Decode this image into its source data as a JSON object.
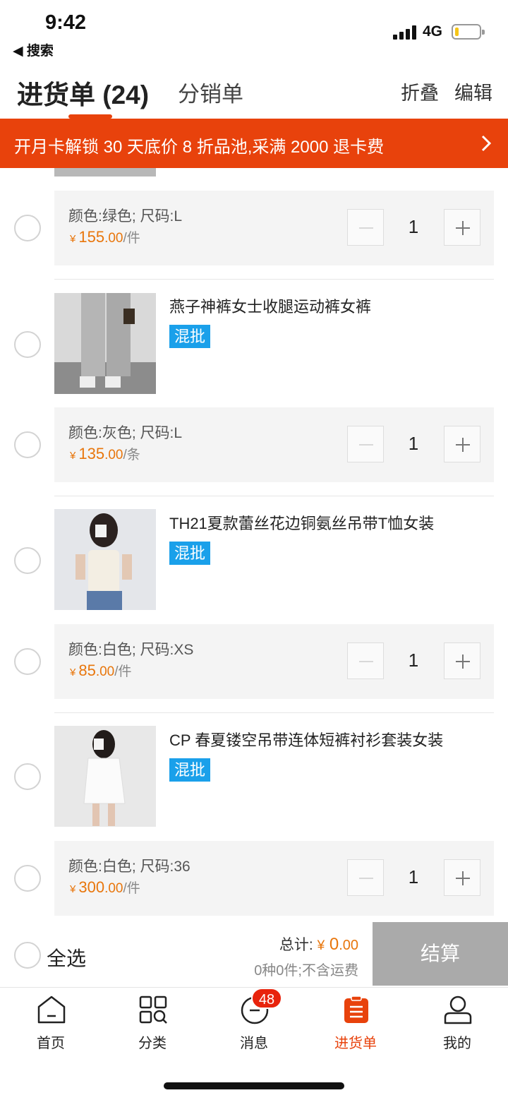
{
  "status_bar": {
    "time": "9:42",
    "back_label": "◀ 搜索",
    "network": "4G"
  },
  "header": {
    "title": "进货单 (24)",
    "tab_distribution": "分销单",
    "fold": "折叠",
    "edit": "编辑"
  },
  "banner": {
    "text": "开月卡解锁 30 天底价 8 折品池,采满 2000 退卡费"
  },
  "items": [
    {
      "sku": {
        "spec": "颜色:绿色; 尺码:L",
        "price_int": "155",
        "price_dec": ".00",
        "unit": "/件",
        "qty": "1"
      }
    },
    {
      "title": "燕子神裤女士收腿运动裤女裤",
      "badge": "混批",
      "sku": {
        "spec": "颜色:灰色; 尺码:L",
        "price_int": "135",
        "price_dec": ".00",
        "unit": "/条",
        "qty": "1"
      }
    },
    {
      "title": "TH21夏款蕾丝花边铜氨丝吊带T恤女装",
      "badge": "混批",
      "sku": {
        "spec": "颜色:白色; 尺码:XS",
        "price_int": "85",
        "price_dec": ".00",
        "unit": "/件",
        "qty": "1"
      }
    },
    {
      "title": "CP 春夏镂空吊带连体短裤衬衫套装女装",
      "badge": "混批",
      "sku": {
        "spec": "颜色:白色; 尺码:36",
        "price_int": "300",
        "price_dec": ".00",
        "unit": "/件",
        "qty": "1"
      }
    }
  ],
  "currency": "¥",
  "checkout": {
    "select_all": "全选",
    "total_label": "总计:",
    "total_int": "0",
    "total_dec": ".00",
    "summary": "0种0件;不含运费",
    "button": "结算"
  },
  "tabbar": {
    "tabs": [
      {
        "label": "首页",
        "icon": "home-icon"
      },
      {
        "label": "分类",
        "icon": "category-icon"
      },
      {
        "label": "消息",
        "icon": "message-icon"
      },
      {
        "label": "进货单",
        "icon": "purchase-list-icon"
      },
      {
        "label": "我的",
        "icon": "profile-icon"
      }
    ],
    "message_badge": "48",
    "active_index": 3
  },
  "colors": {
    "accent": "#e8420c",
    "price": "#e8760c",
    "badge": "#1aa0ea",
    "checkout_disabled": "#aaaaaa"
  }
}
